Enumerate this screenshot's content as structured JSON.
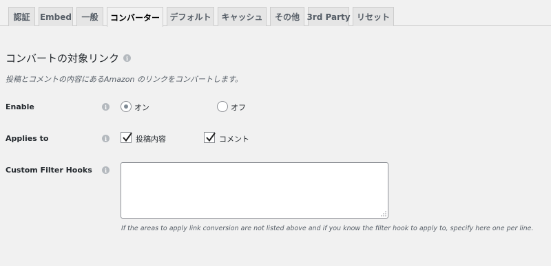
{
  "tabs": [
    {
      "label": "認証",
      "active": false
    },
    {
      "label": "Embed",
      "active": false
    },
    {
      "label": "一般",
      "active": false
    },
    {
      "label": "コンバーター",
      "active": true
    },
    {
      "label": "デフォルト",
      "active": false
    },
    {
      "label": "キャッシュ",
      "active": false
    },
    {
      "label": "その他",
      "active": false
    },
    {
      "label": "3rd Party",
      "active": false
    },
    {
      "label": "リセット",
      "active": false
    }
  ],
  "section": {
    "title": "コンバートの対象リンク",
    "info_glyph": "i",
    "description": "投稿とコメントの内容にあるAmazon のリンクをコンバートします。"
  },
  "enable": {
    "label": "Enable",
    "info_glyph": "i",
    "options": [
      {
        "label": "オン",
        "checked": true
      },
      {
        "label": "オフ",
        "checked": false
      }
    ]
  },
  "applies_to": {
    "label": "Applies to",
    "info_glyph": "i",
    "options": [
      {
        "label": "投稿内容",
        "checked": true
      },
      {
        "label": "コメント",
        "checked": true
      }
    ]
  },
  "custom_filter_hooks": {
    "label": "Custom Filter Hooks",
    "info_glyph": "i",
    "value": "",
    "hint": "If the areas to apply link conversion are not listed above and if you know the filter hook to apply to, specify here one per line."
  },
  "colors": {
    "background": "#f1f1f1",
    "tab_inactive": "#e5e5e5",
    "border": "#cccccc",
    "info_icon": "#b4b9be",
    "control_border": "#8c8f94",
    "checkmark": "#1e1e1e"
  },
  "icons": {
    "info": "info-circle-icon",
    "check": "checkmark-icon",
    "grip": "resize-grip-icon"
  }
}
